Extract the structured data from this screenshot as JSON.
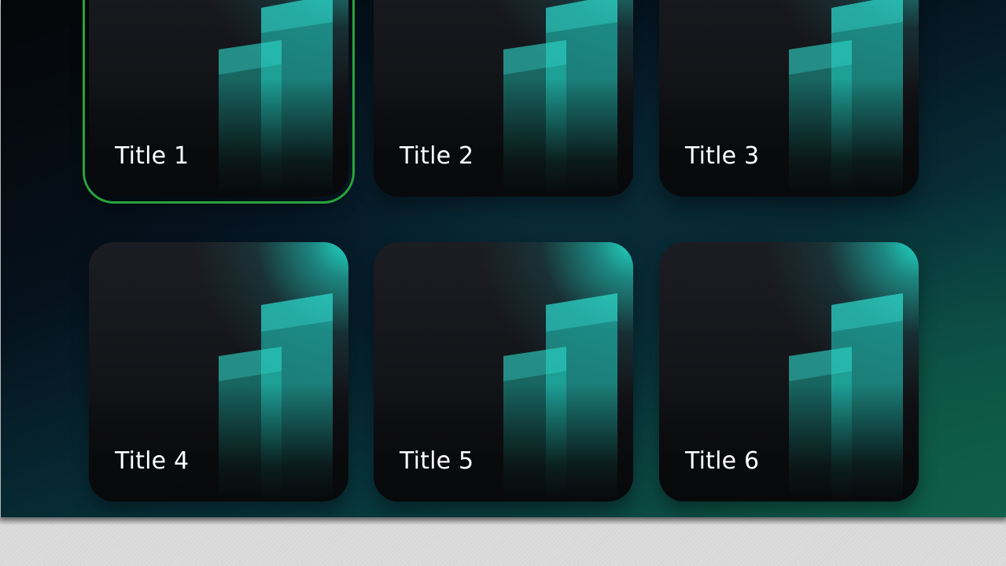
{
  "tiles": [
    {
      "title": "Title 1",
      "selected": true
    },
    {
      "title": "Title 2",
      "selected": false
    },
    {
      "title": "Title 3",
      "selected": false
    },
    {
      "title": "Title 4",
      "selected": false
    },
    {
      "title": "Title 5",
      "selected": false
    },
    {
      "title": "Title 6",
      "selected": false
    }
  ],
  "colors": {
    "accent_teal": "#20d7c4",
    "focus_ring": "#2aa33c",
    "tile_dark": "#111216",
    "background_green": "#0f5f4a"
  },
  "icons": {
    "tile_artwork": "stacked-panels-icon"
  }
}
